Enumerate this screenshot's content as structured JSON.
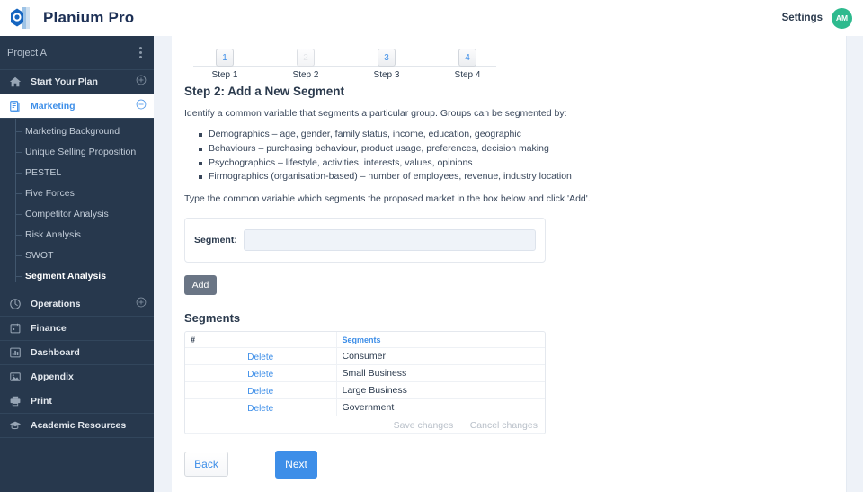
{
  "header": {
    "brand": "Planium Pro",
    "logo_icon": "planium-logo-icon",
    "settings_label": "Settings",
    "avatar_initials": "AM"
  },
  "sidebar": {
    "project_name": "Project A",
    "project_menu_icon": "kebab-menu-icon",
    "items": [
      {
        "label": "Start Your Plan",
        "icon": "home-icon",
        "toggle": "plus-icon",
        "active": false
      },
      {
        "label": "Marketing",
        "icon": "document-icon",
        "toggle": "minus-icon",
        "active": true
      },
      {
        "label": "Operations",
        "icon": "gauge-icon",
        "toggle": "plus-icon",
        "active": false
      },
      {
        "label": "Finance",
        "icon": "calendar-icon",
        "toggle": "",
        "active": false
      },
      {
        "label": "Dashboard",
        "icon": "bar-chart-icon",
        "toggle": "",
        "active": false
      },
      {
        "label": "Appendix",
        "icon": "image-icon",
        "toggle": "",
        "active": false
      },
      {
        "label": "Print",
        "icon": "printer-icon",
        "toggle": "",
        "active": false
      },
      {
        "label": "Academic Resources",
        "icon": "graduation-cap-icon",
        "toggle": "",
        "active": false
      }
    ],
    "submenu": [
      {
        "label": "Marketing Background",
        "current": false
      },
      {
        "label": "Unique Selling Proposition",
        "current": false
      },
      {
        "label": "PESTEL",
        "current": false
      },
      {
        "label": "Five Forces",
        "current": false
      },
      {
        "label": "Competitor Analysis",
        "current": false
      },
      {
        "label": "Risk Analysis",
        "current": false
      },
      {
        "label": "SWOT",
        "current": false
      },
      {
        "label": "Segment Analysis",
        "current": true
      }
    ]
  },
  "stepper": {
    "steps": [
      {
        "number": "1",
        "label": "Step 1",
        "active": false
      },
      {
        "number": "2",
        "label": "Step 2",
        "active": true
      },
      {
        "number": "3",
        "label": "Step 3",
        "active": false
      },
      {
        "number": "4",
        "label": "Step 4",
        "active": false
      }
    ]
  },
  "main": {
    "heading": "Step 2: Add a New Segment",
    "intro": "Identify a common variable that segments a particular group. Groups can be segmented by:",
    "criteria": [
      "Demographics – age, gender, family status, income, education, geographic",
      "Behaviours – purchasing behaviour, product usage, preferences, decision making",
      "Psychographics – lifestyle, activities, interests, values, opinions",
      "Firmographics (organisation-based) – number of employees, revenue, industry location"
    ],
    "instruction": "Type the common variable which segments the proposed market in the box below and click 'Add'.",
    "form": {
      "segment_label": "Segment:",
      "segment_value": "",
      "segment_placeholder": "",
      "add_label": "Add"
    },
    "segments_heading": "Segments",
    "table": {
      "columns": [
        "#",
        "Segments"
      ],
      "rows": [
        {
          "action": "Delete",
          "name": "Consumer"
        },
        {
          "action": "Delete",
          "name": "Small Business"
        },
        {
          "action": "Delete",
          "name": "Large Business"
        },
        {
          "action": "Delete",
          "name": "Government"
        }
      ],
      "save_label": "Save changes",
      "cancel_label": "Cancel changes"
    },
    "back_label": "Back",
    "next_label": "Next"
  },
  "colors": {
    "sidebar_bg": "#27384d",
    "accent_blue": "#3d8ee8",
    "avatar_green": "#2eba8e",
    "add_button_grey": "#6a7585"
  }
}
